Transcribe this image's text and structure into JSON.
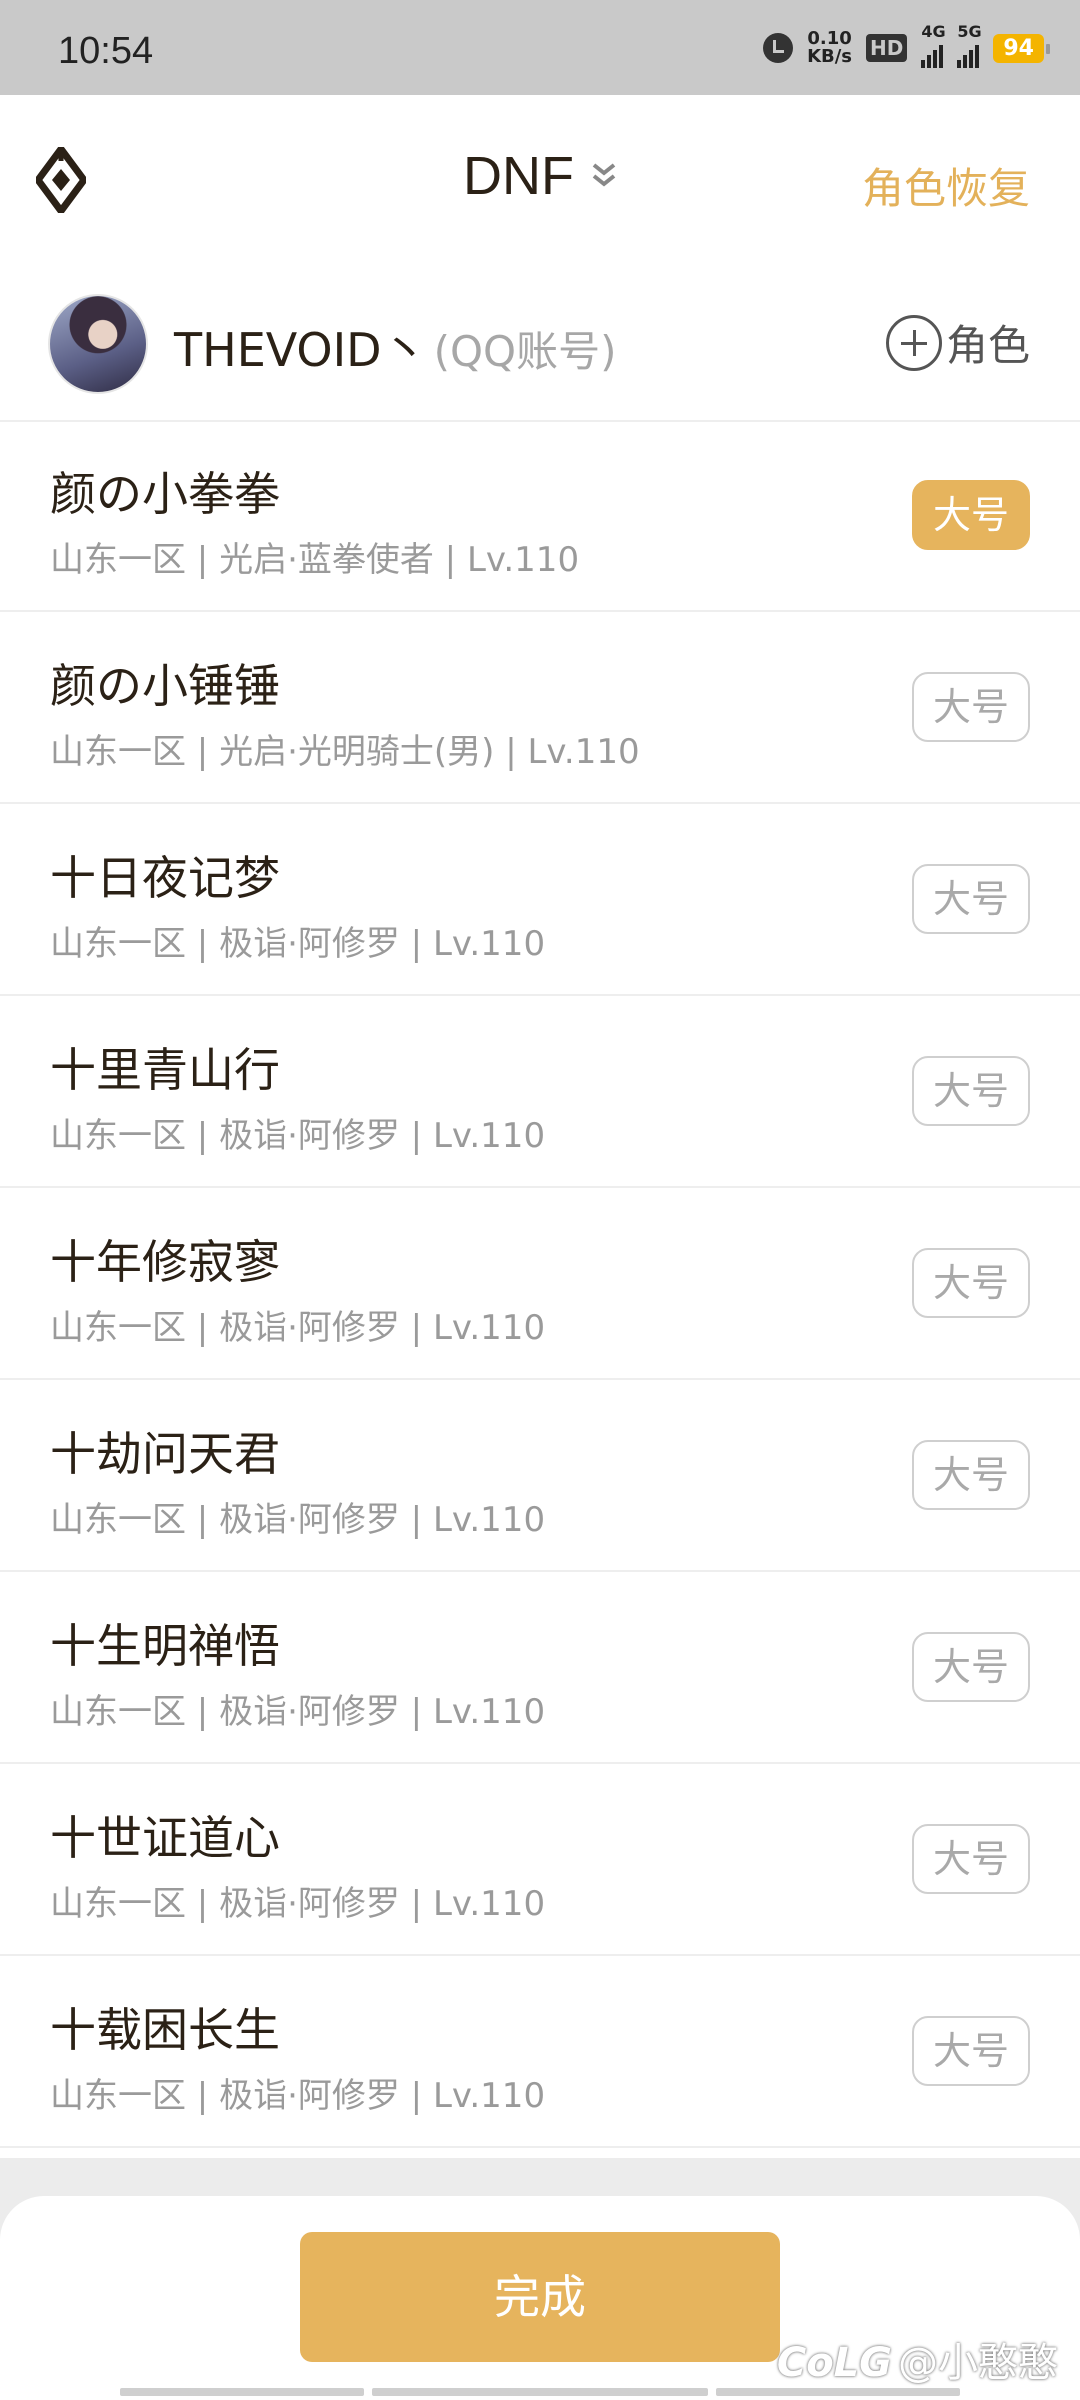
{
  "status_bar": {
    "time": "10:54",
    "net_speed_value": "0.10",
    "net_speed_unit": "KB/s",
    "hd_label": "HD",
    "signal_4g": "4G",
    "signal_5g": "5G",
    "battery": "94",
    "icons": [
      "alarm-icon",
      "hd-icon",
      "signal-4g-icon",
      "signal-5g-icon",
      "battery-icon"
    ]
  },
  "header": {
    "title": "DNF",
    "restore_label": "角色恢复",
    "icons": [
      "dnf-logo-icon",
      "chevron-down-double-icon"
    ]
  },
  "account": {
    "name": "THEVOID丶",
    "type": "(QQ账号)",
    "add_role_label": "角色"
  },
  "roles": [
    {
      "name": "颜の小拳拳",
      "sub": "山东一区 | 光启·蓝拳使者 | Lv.110",
      "tag": "大号",
      "active": true
    },
    {
      "name": "颜の小锤锤",
      "sub": "山东一区 | 光启·光明骑士(男) | Lv.110",
      "tag": "大号",
      "active": false
    },
    {
      "name": "十日夜记梦",
      "sub": "山东一区 | 极诣·阿修罗 | Lv.110",
      "tag": "大号",
      "active": false
    },
    {
      "name": "十里青山行",
      "sub": "山东一区 | 极诣·阿修罗 | Lv.110",
      "tag": "大号",
      "active": false
    },
    {
      "name": "十年修寂寥",
      "sub": "山东一区 | 极诣·阿修罗 | Lv.110",
      "tag": "大号",
      "active": false
    },
    {
      "name": "十劫问天君",
      "sub": "山东一区 | 极诣·阿修罗 | Lv.110",
      "tag": "大号",
      "active": false
    },
    {
      "name": "十生明禅悟",
      "sub": "山东一区 | 极诣·阿修罗 | Lv.110",
      "tag": "大号",
      "active": false
    },
    {
      "name": "十世证道心",
      "sub": "山东一区 | 极诣·阿修罗 | Lv.110",
      "tag": "大号",
      "active": false
    },
    {
      "name": "十载困长生",
      "sub": "山东一区 | 极诣·阿修罗 | Lv.110",
      "tag": "大号",
      "active": false
    }
  ],
  "footer": {
    "done_label": "完成",
    "watermark_brand": "CoLG",
    "watermark_user": "@小憨憨"
  },
  "colors": {
    "accent": "#e6b45d",
    "restore_text": "#e3b15a",
    "title_text": "#2b2116",
    "sub_text": "#9a9a9a",
    "divider": "#eeeeee",
    "status_bar_bg": "#c9c9c9"
  }
}
